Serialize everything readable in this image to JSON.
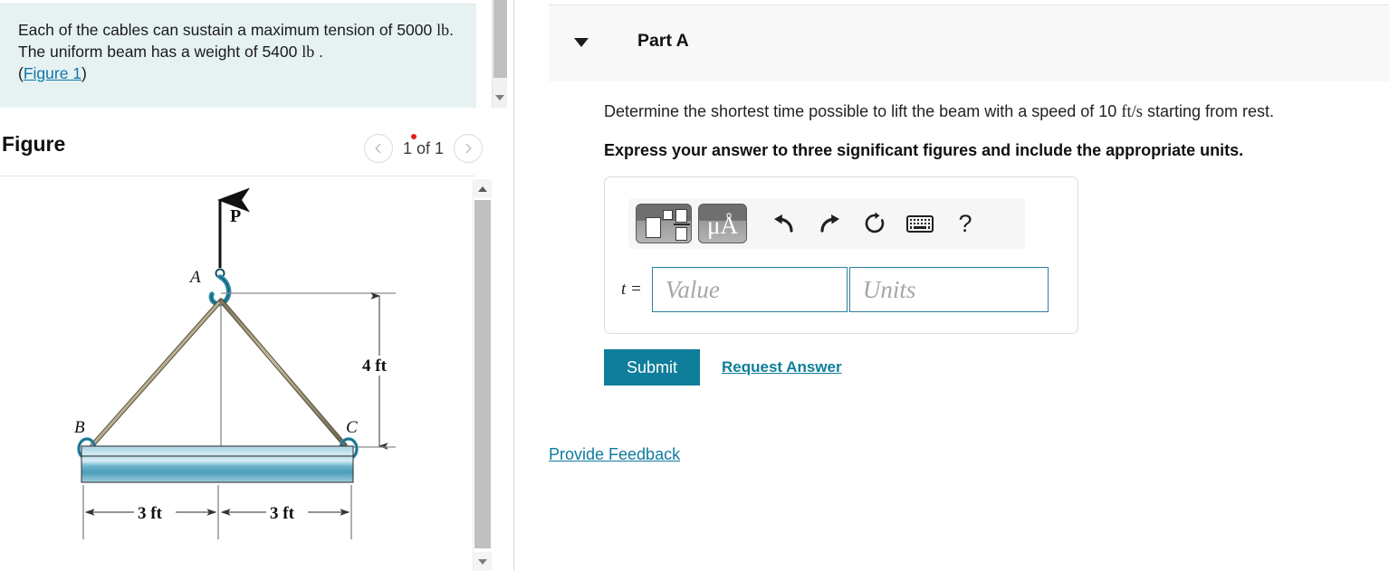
{
  "question": {
    "text_part1": "Each of the cables can sustain a maximum tension of 5000 ",
    "unit1": "lb",
    "text_part2": ". The uniform beam has a weight of 5400  ",
    "unit2": "lb",
    "text_part3": " .",
    "figure_link": "Figure 1",
    "open_paren": "(",
    "close_paren": ")"
  },
  "figure": {
    "title": "Figure",
    "counter": "1 of 1",
    "prev_icon": "chevron-left-icon",
    "next_icon": "chevron-right-icon",
    "labels": {
      "force_P": "P",
      "point_A": "A",
      "point_B": "B",
      "point_C": "C",
      "height": "4 ft",
      "left_span": "3 ft",
      "right_span": "3 ft"
    }
  },
  "part_a": {
    "caret_icon": "caret-down-icon",
    "label": "Part A",
    "prompt_pre": "Determine the shortest time possible to lift the beam with a speed of 10 ",
    "prompt_unit": "ft/s",
    "prompt_post": " starting from rest.",
    "express": "Express your answer to three significant figures and include the appropriate units."
  },
  "answer": {
    "toolbar": {
      "template_icon": "math-template-icon",
      "units_icon": "micro-angstrom-units-icon",
      "undo_icon": "undo-arrow-icon",
      "redo_icon": "redo-arrow-icon",
      "reset_icon": "reset-circular-arrow-icon",
      "keyboard_icon": "keyboard-icon",
      "help_icon": "question-mark-icon",
      "help_label": "?"
    },
    "variable_label": "t =",
    "value_placeholder": "Value",
    "value": "",
    "units_placeholder": "Units",
    "units": ""
  },
  "actions": {
    "submit": "Submit",
    "request_answer": "Request Answer",
    "provide_feedback": "Provide Feedback"
  },
  "colors": {
    "accent": "#0f7e9b",
    "question_bg": "#e6f2f2",
    "link": "#1175a8",
    "input_border": "#2c7fa0",
    "notification_dot": "#e0201b"
  }
}
